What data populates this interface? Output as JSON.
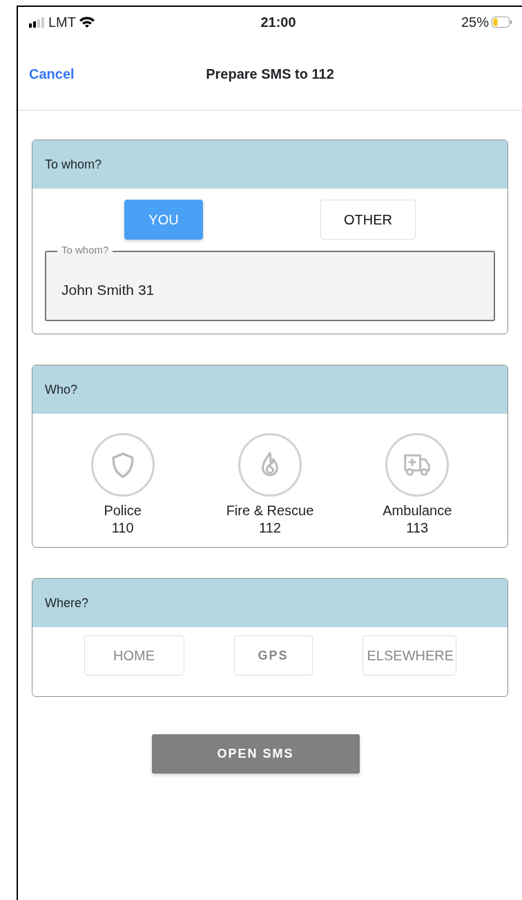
{
  "status_bar": {
    "carrier": "LMT",
    "time": "21:00",
    "battery": "25%"
  },
  "nav": {
    "cancel": "Cancel",
    "title": "Prepare SMS to 112"
  },
  "recipient": {
    "title": "To whom?",
    "options": [
      {
        "label": "YOU",
        "selected": true
      },
      {
        "label": "OTHER",
        "selected": false
      }
    ],
    "field": {
      "label": "To whom?",
      "value": "John Smith 31"
    }
  },
  "services": {
    "title": "Who?",
    "items": [
      {
        "kind": "police",
        "name": "Police",
        "number": "110",
        "selected": false
      },
      {
        "kind": "fire",
        "name": "Fire & Rescue",
        "number": "112",
        "selected": false
      },
      {
        "kind": "ambulance",
        "name": "Ambulance",
        "number": "113",
        "selected": false
      }
    ]
  },
  "location": {
    "title": "Where?",
    "options": [
      {
        "label": "HOME",
        "selected": false
      },
      {
        "label": "GPS",
        "selected": false
      },
      {
        "label": "ELSEWHERE",
        "selected": false
      }
    ]
  },
  "open_button": {
    "label": "OPEN SMS",
    "disabled": true
  }
}
